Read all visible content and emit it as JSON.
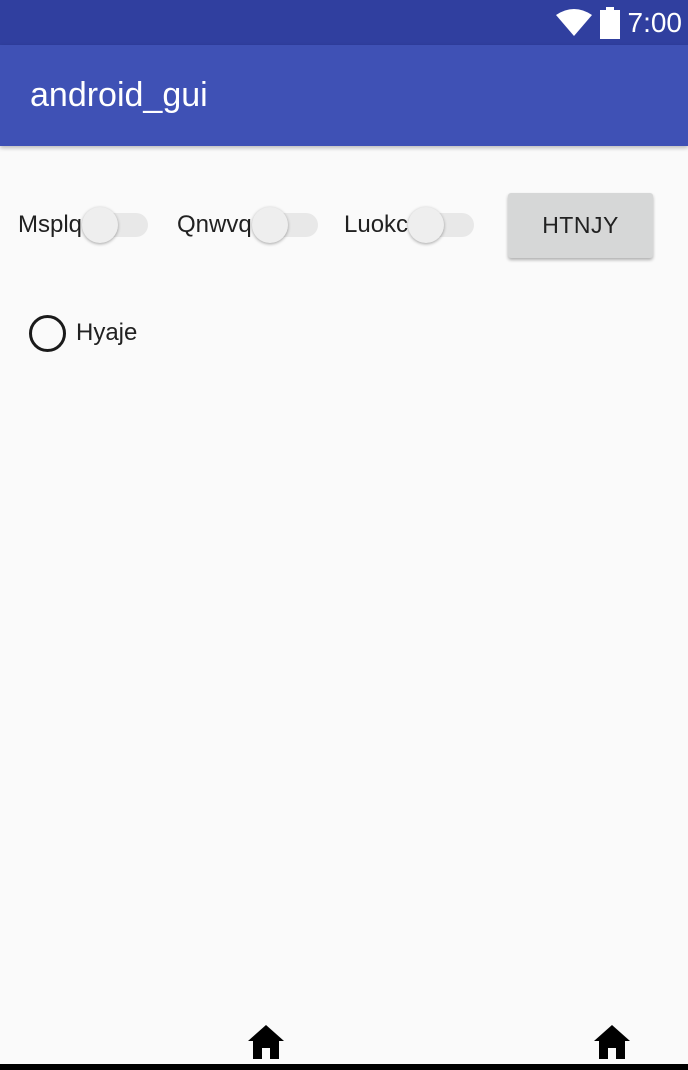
{
  "status_bar": {
    "time": "7:00",
    "icons": [
      "wifi-icon",
      "battery-icon"
    ],
    "color": "#303f9f"
  },
  "app_bar": {
    "title": "android_gui",
    "color": "#3f51b5"
  },
  "switches": [
    {
      "label": "Msplq",
      "checked": false
    },
    {
      "label": "Qnwvq",
      "checked": false
    },
    {
      "label": "Luokc",
      "checked": false
    }
  ],
  "button": {
    "label": "HTNJY"
  },
  "radio": {
    "label": "Hyaje",
    "checked": false
  },
  "bottom_nav": {
    "icons": [
      "home-icon",
      "home-icon"
    ]
  }
}
